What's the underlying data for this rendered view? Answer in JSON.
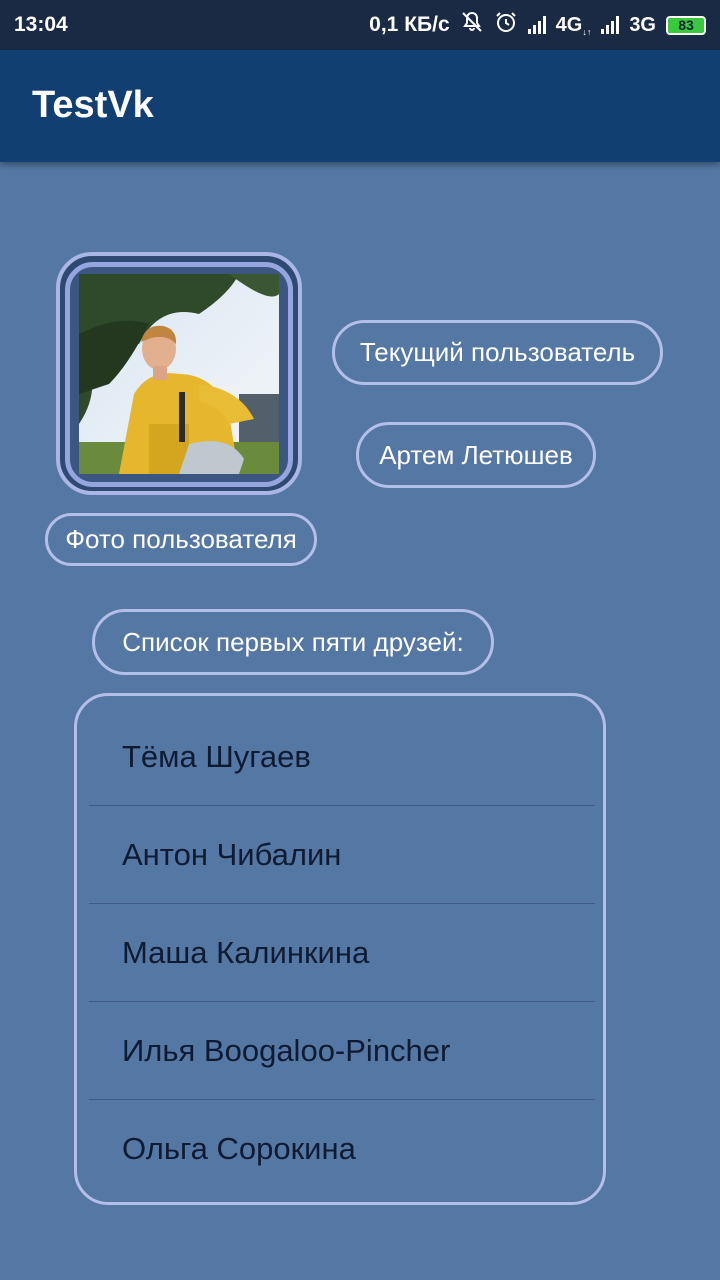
{
  "status_bar": {
    "time": "13:04",
    "speed": "0,1 КБ/с",
    "net1": "4G",
    "net2": "3G",
    "battery": "83",
    "icons": [
      "mute-bell-icon",
      "alarm-icon",
      "signal-icon",
      "signal-icon"
    ]
  },
  "app_bar": {
    "title": "TestVk"
  },
  "profile": {
    "photo_label": "Фото пользователя",
    "current_user_label": "Текущий пользователь",
    "user_name": "Артем Летюшев"
  },
  "friends": {
    "header": "Список первых пяти друзей:",
    "items": [
      "Тёма Шугаев",
      "Антон Чибалин",
      "Маша Калинкина",
      "Илья Boogaloo-Pincher",
      "Ольга Сорокина"
    ]
  },
  "colors": {
    "background": "#5577a3",
    "app_bar": "#123f72",
    "status_bar": "#1b2a44",
    "outline": "#b4bfe9",
    "battery": "#39c83e"
  }
}
